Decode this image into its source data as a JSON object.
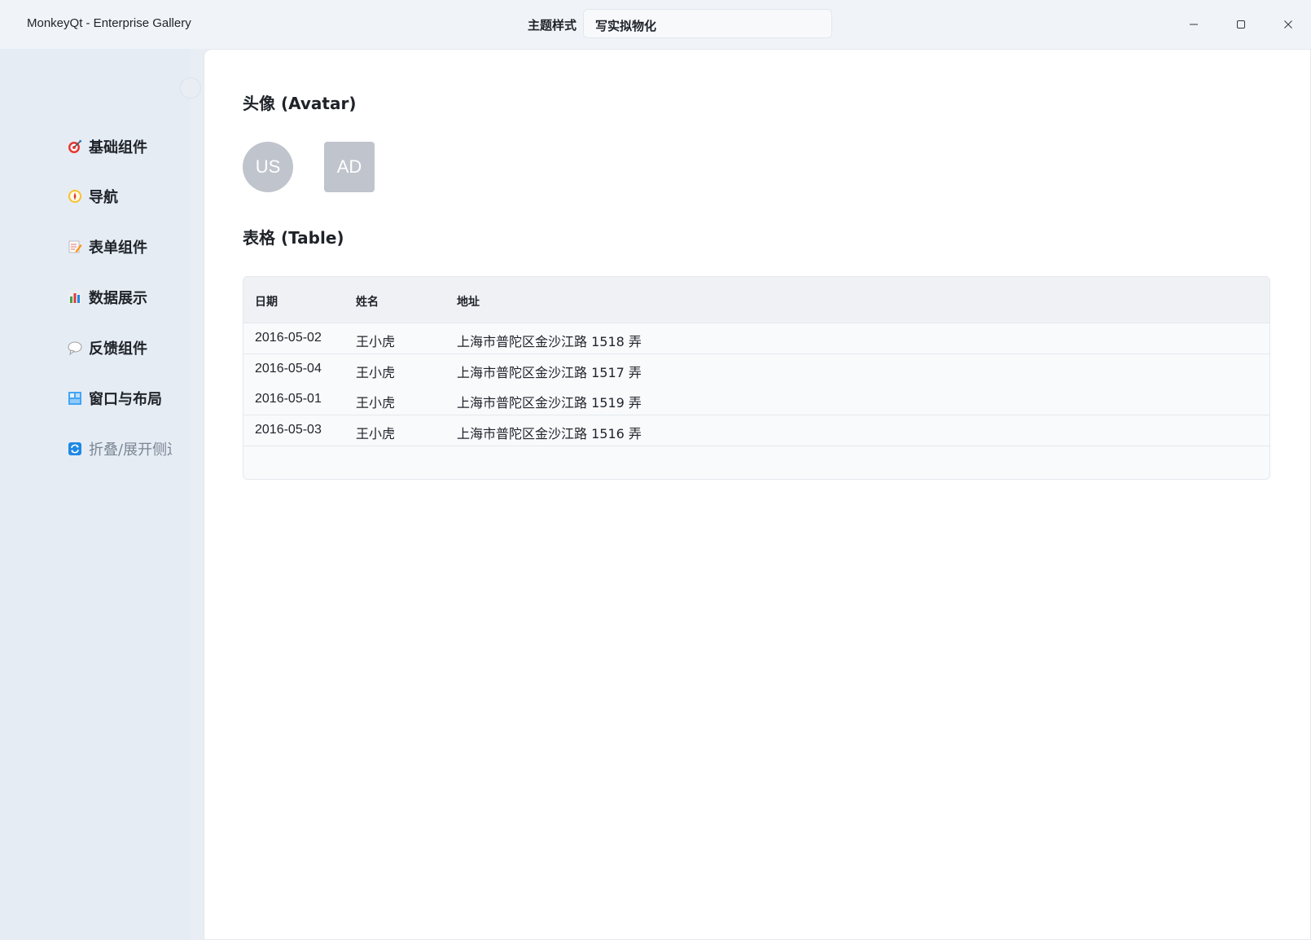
{
  "window": {
    "title": "MonkeyQt - Enterprise Gallery",
    "theme_label": "主题样式",
    "theme_value": "写实拟物化"
  },
  "sidebar": {
    "items": [
      {
        "label": "基础组件",
        "icon": "target-icon"
      },
      {
        "label": "导航",
        "icon": "compass-icon"
      },
      {
        "label": "表单组件",
        "icon": "memo-icon"
      },
      {
        "label": "数据展示",
        "icon": "bar-chart-icon"
      },
      {
        "label": "反馈组件",
        "icon": "speech-bubble-icon"
      },
      {
        "label": "窗口与布局",
        "icon": "window-icon"
      }
    ],
    "collapse_label": "折叠/展开侧边栏"
  },
  "main": {
    "avatar_section_title": "头像 (Avatar)",
    "avatars": [
      "US",
      "AD"
    ],
    "table_section_title": "表格 (Table)",
    "table": {
      "columns": [
        "日期",
        "姓名",
        "地址"
      ],
      "rows": [
        [
          "2016-05-02",
          "王小虎",
          "上海市普陀区金沙江路 1518 弄"
        ],
        [
          "2016-05-04",
          "王小虎",
          "上海市普陀区金沙江路 1517 弄"
        ],
        [
          "2016-05-01",
          "王小虎",
          "上海市普陀区金沙江路 1519 弄"
        ],
        [
          "2016-05-03",
          "王小虎",
          "上海市普陀区金沙江路 1516 弄"
        ]
      ]
    }
  },
  "colors": {
    "avatar_bg": "#c0c4cc",
    "sidebar_bg": "#e6ecf4",
    "header_bg": "#eff1f4"
  }
}
